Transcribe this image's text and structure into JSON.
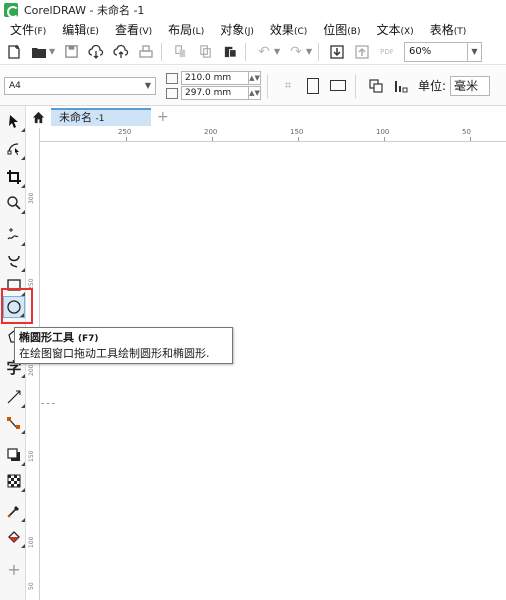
{
  "app": {
    "title": "CorelDRAW - 未命名 -1"
  },
  "menu": [
    {
      "label": "文件",
      "accel": "(F)"
    },
    {
      "label": "编辑",
      "accel": "(E)"
    },
    {
      "label": "查看",
      "accel": "(V)"
    },
    {
      "label": "布局",
      "accel": "(L)"
    },
    {
      "label": "对象",
      "accel": "(J)"
    },
    {
      "label": "效果",
      "accel": "(C)"
    },
    {
      "label": "位图",
      "accel": "(B)"
    },
    {
      "label": "文本",
      "accel": "(X)"
    },
    {
      "label": "表格",
      "accel": "(T)"
    }
  ],
  "toolbar": {
    "zoom": "60%",
    "pdf_label": "PDF"
  },
  "propbar": {
    "page_size": "A4",
    "width": "210.0 mm",
    "height": "297.0 mm",
    "unit_label": "单位:",
    "unit_value": "毫米"
  },
  "document": {
    "tab_name": "未命名",
    "tab_suffix": "-1"
  },
  "ruler": {
    "h_ticks": [
      "250",
      "200",
      "150",
      "100",
      "50"
    ],
    "v_ticks": [
      "300",
      "250",
      "200",
      "150",
      "100",
      "50"
    ]
  },
  "tooltip": {
    "title": "椭圆形工具",
    "shortcut": "(F7)",
    "description": "在绘图窗口拖动工具绘制圆形和椭圆形."
  },
  "colors": {
    "highlight": "#e8322e",
    "tab_active": "#cfe3f6",
    "brand": "#2fa84f"
  }
}
